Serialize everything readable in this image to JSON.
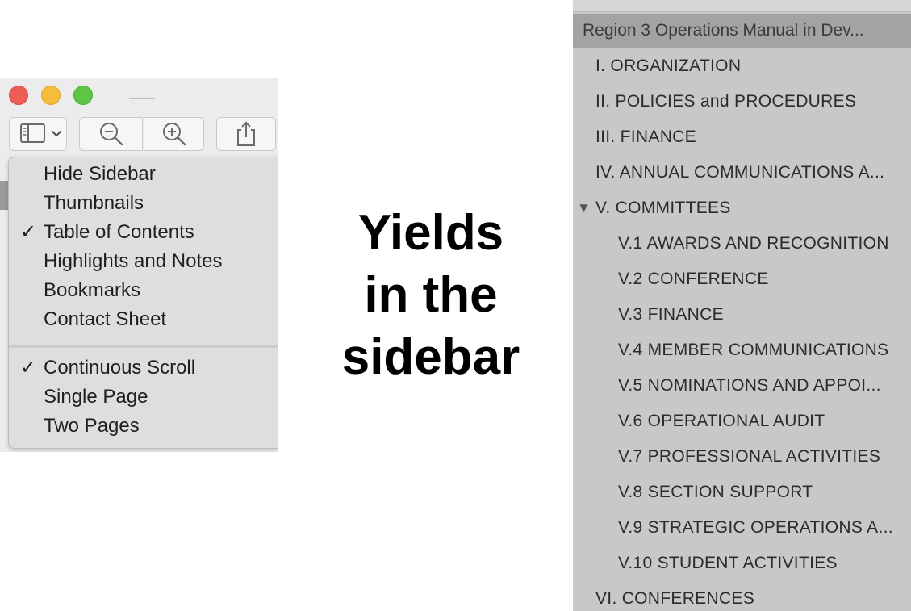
{
  "menu": {
    "view_items": [
      {
        "label": "Hide Sidebar",
        "checked": false
      },
      {
        "label": "Thumbnails",
        "checked": false
      },
      {
        "label": "Table of Contents",
        "checked": true
      },
      {
        "label": "Highlights and Notes",
        "checked": false
      },
      {
        "label": "Bookmarks",
        "checked": false
      },
      {
        "label": "Contact Sheet",
        "checked": false
      }
    ],
    "layout_items": [
      {
        "label": "Continuous Scroll",
        "checked": true
      },
      {
        "label": "Single Page",
        "checked": false
      },
      {
        "label": "Two Pages",
        "checked": false
      }
    ],
    "check_glyph": "✓"
  },
  "caption": {
    "line1": "Yields",
    "line2": "in the",
    "line3": "sidebar"
  },
  "toc": {
    "header": "Region 3 Operations Manual in Dev...",
    "disclosure_glyph": "▼",
    "items": [
      {
        "label": "I.  ORGANIZATION",
        "level": 0
      },
      {
        "label": "II.  POLICIES and PROCEDURES",
        "level": 0
      },
      {
        "label": "III.  FINANCE",
        "level": 0
      },
      {
        "label": "IV.  ANNUAL COMMUNICATIONS A...",
        "level": 0
      },
      {
        "label": "V.  COMMITTEES",
        "level": 0,
        "expanded": true
      },
      {
        "label": "V.1  AWARDS AND RECOGNITION",
        "level": 1
      },
      {
        "label": "V.2 CONFERENCE",
        "level": 1
      },
      {
        "label": "V.3 FINANCE",
        "level": 1
      },
      {
        "label": "V.4 MEMBER COMMUNICATIONS",
        "level": 1
      },
      {
        "label": "V.5 NOMINATIONS AND APPOI...",
        "level": 1
      },
      {
        "label": "V.6 OPERATIONAL AUDIT",
        "level": 1
      },
      {
        "label": "V.7 PROFESSIONAL ACTIVITIES",
        "level": 1
      },
      {
        "label": "V.8 SECTION SUPPORT",
        "level": 1
      },
      {
        "label": "V.9 STRATEGIC OPERATIONS A...",
        "level": 1
      },
      {
        "label": "V.10 STUDENT ACTIVITIES",
        "level": 1
      },
      {
        "label": "VI. CONFERENCES",
        "level": 0
      }
    ]
  },
  "icons": {
    "sidebar_button": "sidebar-icon",
    "zoom_out": "zoom-out-icon",
    "zoom_in": "zoom-in-icon",
    "share": "share-icon"
  }
}
